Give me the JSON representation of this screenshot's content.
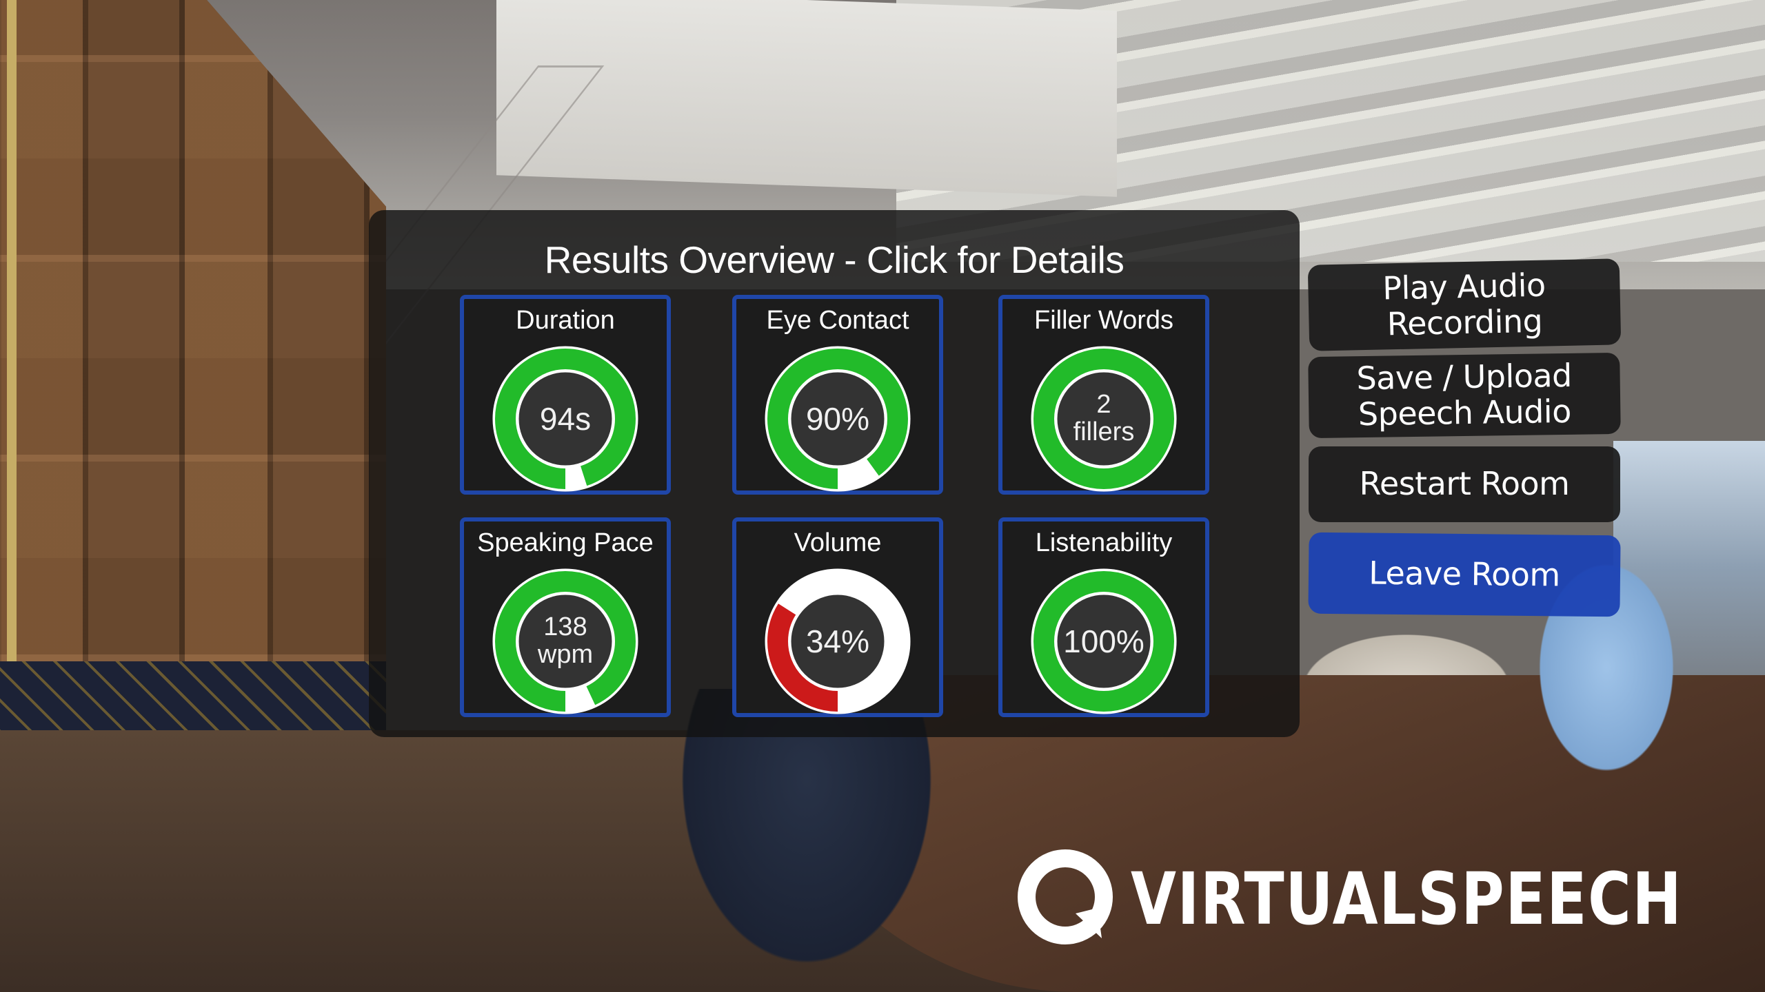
{
  "panel": {
    "title": "Results Overview - Click for Details"
  },
  "metrics": [
    {
      "label": "Duration",
      "value_lines": [
        "94s"
      ],
      "fill_fraction": 0.95,
      "fill_color": "#22bb2a",
      "track_color": "#ffffff"
    },
    {
      "label": "Eye Contact",
      "value_lines": [
        "90%"
      ],
      "fill_fraction": 0.9,
      "fill_color": "#22bb2a",
      "track_color": "#ffffff"
    },
    {
      "label": "Filler Words",
      "value_lines": [
        "2",
        "fillers"
      ],
      "fill_fraction": 1.0,
      "fill_color": "#22bb2a",
      "track_color": "#ffffff"
    },
    {
      "label": "Speaking Pace",
      "value_lines": [
        "138",
        "wpm"
      ],
      "fill_fraction": 0.93,
      "fill_color": "#22bb2a",
      "track_color": "#ffffff"
    },
    {
      "label": "Volume",
      "value_lines": [
        "34%"
      ],
      "fill_fraction": 0.34,
      "fill_color": "#cc1a1a",
      "track_color": "#ffffff"
    },
    {
      "label": "Listenability",
      "value_lines": [
        "100%"
      ],
      "fill_fraction": 1.0,
      "fill_color": "#22bb2a",
      "track_color": "#ffffff"
    }
  ],
  "buttons": {
    "play_audio": [
      "Play Audio",
      "Recording"
    ],
    "save_upload": [
      "Save / Upload",
      "Speech Audio"
    ],
    "restart": "Restart Room",
    "leave": "Leave Room"
  },
  "logo": {
    "text": "VIRTUALSPEECH",
    "icon": "speech-bubble-icon"
  },
  "colors": {
    "tile_border": "#1f46a8",
    "good": "#22bb2a",
    "bad": "#cc1a1a",
    "primary_button": "#1c42b4"
  }
}
